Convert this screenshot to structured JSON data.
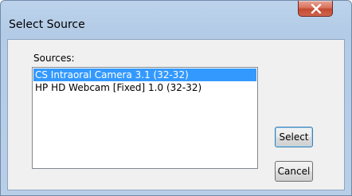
{
  "window": {
    "title": "Select Source"
  },
  "sources": {
    "label": "Sources:",
    "items": [
      {
        "label": "CS Intraoral Camera 3.1 (32-32)",
        "selected": true
      },
      {
        "label": "HP HD Webcam [Fixed] 1.0 (32-32)",
        "selected": false
      }
    ]
  },
  "buttons": {
    "select_label": "Select",
    "cancel_label": "Cancel"
  },
  "icons": {
    "close": "close-icon"
  },
  "colors": {
    "selection": "#3399ff",
    "close_button": "#c24b32"
  }
}
